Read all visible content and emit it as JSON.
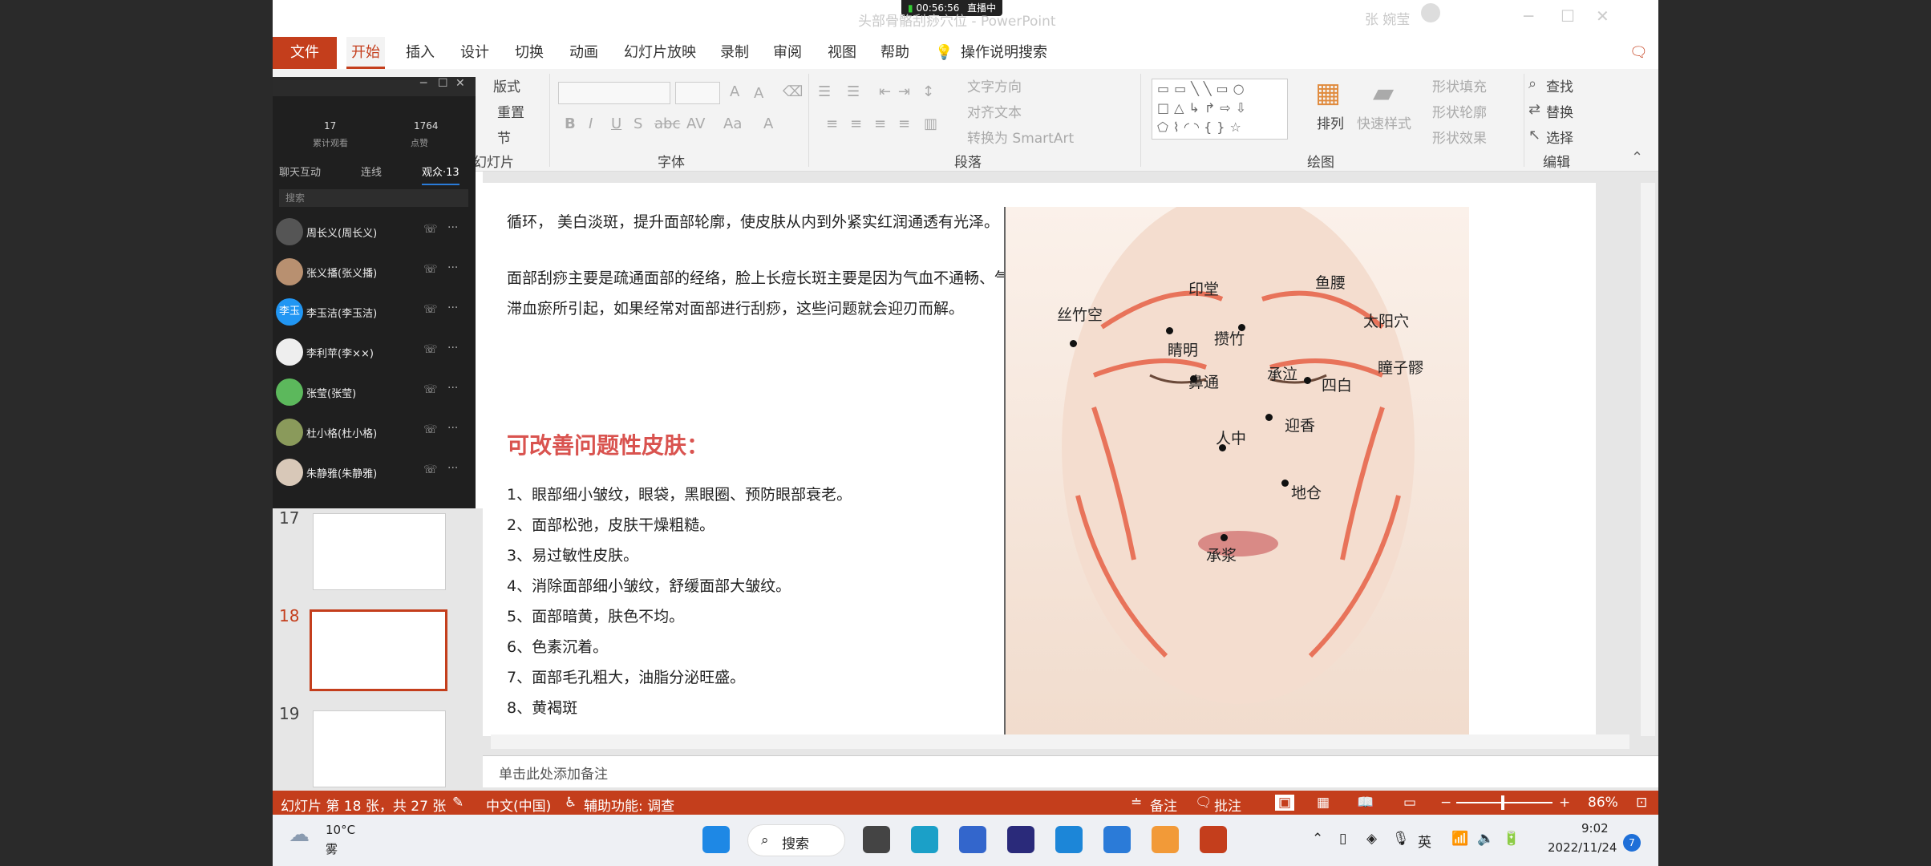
{
  "window": {
    "title": "头部骨骼刮痧穴位 - PowerPoint",
    "user": "张 婉莹",
    "live_timer": "00:56:56",
    "live_status": "直播中"
  },
  "tabs": [
    "文件",
    "开始",
    "插入",
    "设计",
    "切换",
    "动画",
    "幻灯片放映",
    "录制",
    "审阅",
    "视图",
    "帮助",
    "操作说明搜索"
  ],
  "ribbon": {
    "slides": {
      "layout": "版式",
      "reset": "重置",
      "section": "节",
      "label": "幻灯片"
    },
    "font": {
      "label": "字体"
    },
    "paragraph": {
      "text_direction": "文字方向",
      "align_text": "对齐文本",
      "smartart": "转换为 SmartArt",
      "label": "段落"
    },
    "drawing": {
      "arrange": "排列",
      "quick_styles": "快速样式",
      "shape_fill": "形状填充",
      "shape_outline": "形状轮廓",
      "shape_effects": "形状效果",
      "label": "绘图"
    },
    "editing": {
      "find": "查找",
      "replace": "替换",
      "select": "选择",
      "label": "编辑"
    }
  },
  "live_panel": {
    "stats": [
      {
        "value": "17",
        "label": "累计观看"
      },
      {
        "value": "1764",
        "label": "点赞"
      }
    ],
    "tabs": [
      "聊天互动",
      "连线",
      "观众·13"
    ],
    "search_placeholder": "搜索",
    "audience": [
      {
        "name": "周长义(周长义)",
        "avatar": ""
      },
      {
        "name": "张义播(张义播)",
        "avatar": ""
      },
      {
        "name": "李玉洁(李玉洁)",
        "avatar": "李玉"
      },
      {
        "name": "李利苹(李××)",
        "avatar": ""
      },
      {
        "name": "张莹(张莹)",
        "avatar": ""
      },
      {
        "name": "杜小格(杜小格)",
        "avatar": ""
      },
      {
        "name": "朱静雅(朱静雅)",
        "avatar": ""
      }
    ]
  },
  "thumbnails": [
    {
      "num": "17"
    },
    {
      "num": "18"
    },
    {
      "num": "19"
    }
  ],
  "slide": {
    "para1": "循环， 美白淡斑，提升面部轮廓，使皮肤从内到外紧实红润通透有光泽。",
    "para2_line1": "面部刮痧主要是疏通面部的经络，脸上长痘长斑主要是因为气血不通畅、气",
    "para2_line2": "滞血瘀所引起，如果经常对面部进行刮痧，这些问题就会迎刃而解。",
    "heading": "可改善问题性皮肤：",
    "list": [
      "1、眼部细小皱纹，眼袋，黑眼圈、预防眼部衰老。",
      "2、面部松弛，皮肤干燥粗糙。",
      "3、易过敏性皮肤。",
      "4、消除面部细小皱纹，舒缓面部大皱纹。",
      "5、面部暗黄，肤色不均。",
      "6、色素沉着。",
      "7、面部毛孔粗大，油脂分泌旺盛。",
      "8、黄褐斑"
    ],
    "points": [
      "印堂",
      "鱼腰",
      "丝竹空",
      "太阳穴",
      "攒竹",
      "睛明",
      "瞳子髎",
      "鼻通",
      "承泣",
      "四白",
      "迎香",
      "人中",
      "地仓",
      "承浆"
    ]
  },
  "notes_placeholder": "单击此处添加备注",
  "status_bar": {
    "slide_info": "幻灯片 第 18 张，共 27 张",
    "language": "中文(中国)",
    "accessibility": "辅助功能: 调查",
    "notes": "备注",
    "comments": "批注",
    "zoom": "86%"
  },
  "taskbar": {
    "weather_temp": "10°C",
    "weather_desc": "雾",
    "search": "搜索",
    "ime": "英",
    "time": "9:02",
    "date": "2022/11/24",
    "notif_count": "7"
  },
  "colors": {
    "accent": "#c43e1c",
    "heading": "#d9534f",
    "arrow": "#e8735a"
  }
}
